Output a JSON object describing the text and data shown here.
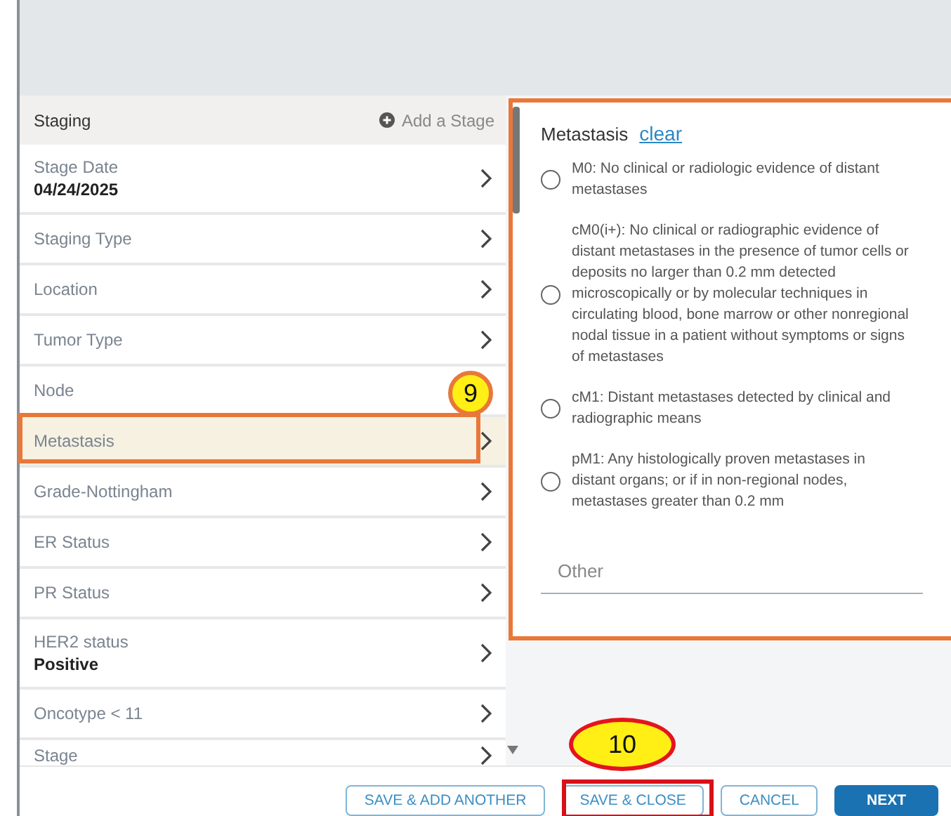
{
  "staging": {
    "title": "Staging",
    "add_action": "Add a Stage",
    "items": [
      {
        "label": "Stage Date",
        "value": "04/24/2025",
        "selected": false,
        "chevron": true
      },
      {
        "label": "Staging Type",
        "selected": false,
        "chevron": true
      },
      {
        "label": "Location",
        "selected": false,
        "chevron": true
      },
      {
        "label": "Tumor Type",
        "selected": false,
        "chevron": true
      },
      {
        "label": "Node",
        "selected": false,
        "chevron": false
      },
      {
        "label": "Metastasis",
        "selected": true,
        "chevron": true
      },
      {
        "label": "Grade-Nottingham",
        "selected": false,
        "chevron": true
      },
      {
        "label": "ER Status",
        "selected": false,
        "chevron": true
      },
      {
        "label": "PR Status",
        "selected": false,
        "chevron": true
      },
      {
        "label": "HER2 status",
        "value": "Positive",
        "selected": false,
        "chevron": true
      },
      {
        "label": "Oncotype < 11",
        "selected": false,
        "chevron": true
      },
      {
        "label": "Stage",
        "selected": false,
        "chevron": true
      }
    ]
  },
  "panel": {
    "title": "Metastasis",
    "clear": "clear",
    "options": [
      {
        "text": "M0: No clinical or radiologic evidence of distant metastases",
        "selected": false
      },
      {
        "text": "cM0(i+): No clinical or radiographic evidence of distant metastases in the presence of tumor cells or deposits no larger than 0.2 mm detected microscopically or by molecular techniques in circulating blood, bone marrow or other nonregional nodal tissue in a patient without symptoms or signs of metastases",
        "selected": false
      },
      {
        "text": "cM1: Distant metastases detected by clinical and radiographic means",
        "selected": false
      },
      {
        "text": "pM1: Any histologically proven metastases in distant organs; or if in non-regional nodes, metastases greater than 0.2 mm",
        "selected": false
      }
    ],
    "other": {
      "placeholder": "Other"
    }
  },
  "buttons": [
    {
      "label": "SAVE & ADD ANOTHER",
      "kind": "outline"
    },
    {
      "label": "SAVE & CLOSE",
      "kind": "outline"
    },
    {
      "label": "CANCEL",
      "kind": "outline"
    },
    {
      "label": "NEXT",
      "kind": "primary"
    }
  ],
  "annotations": [
    {
      "label": "9",
      "kind": "circle"
    },
    {
      "label": "10",
      "kind": "ellipse"
    }
  ]
}
